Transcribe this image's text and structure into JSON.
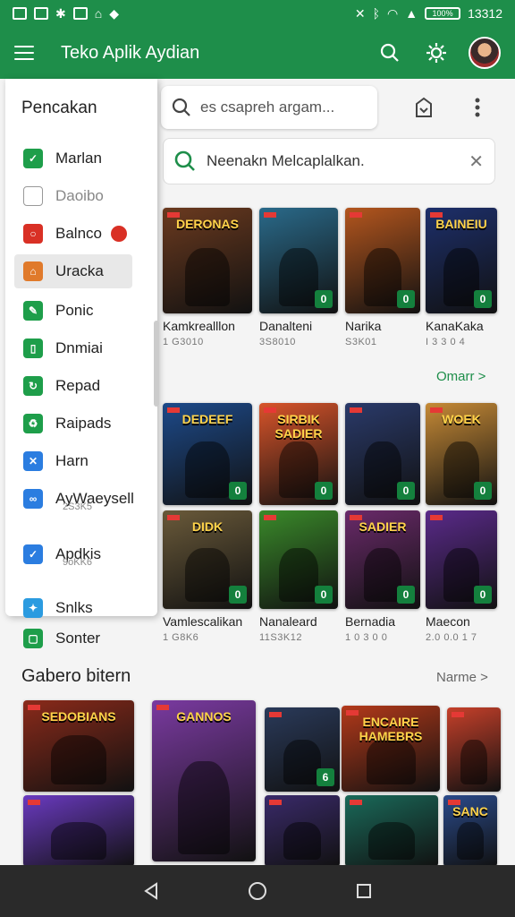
{
  "status": {
    "time": "13312",
    "battery": "100%"
  },
  "appbar": {
    "title": "Teko Aplik Aydian"
  },
  "search": {
    "placeholder": "es csapreh argam..."
  },
  "suggestion": {
    "text": "Neenakn Melcaplalkan.",
    "close": "✕"
  },
  "drawer": {
    "title": "Pencakan",
    "items": [
      {
        "label": "Marlan",
        "color": "#1e9e4a",
        "glyph": "✓"
      },
      {
        "label": "Daoibo",
        "color": "#ffffff",
        "glyph": ""
      },
      {
        "label": "Balnco",
        "color": "#d93025",
        "glyph": "○"
      },
      {
        "label": "Uracka",
        "color": "#e07a2b",
        "glyph": "⌂"
      },
      {
        "label": "Ponic",
        "color": "#1e9e4a",
        "glyph": "✎"
      },
      {
        "label": "Dnmiai",
        "color": "#1e9e4a",
        "glyph": "▯"
      },
      {
        "label": "Repad",
        "color": "#1e9e4a",
        "glyph": "↻"
      },
      {
        "label": "Raipads",
        "color": "#1e9e4a",
        "glyph": "♻"
      },
      {
        "label": "Harn",
        "color": "#2b7de0",
        "glyph": "✕"
      },
      {
        "label": "AyWaeysell",
        "color": "#2b7de0",
        "glyph": "∞"
      },
      {
        "label": "Apdkis",
        "color": "#2b7de0",
        "glyph": "✓"
      },
      {
        "label": "Snlks",
        "color": "#2b9be0",
        "glyph": "✦"
      }
    ],
    "subs": {
      "aywaeysell": "2S3K5",
      "apdkis": "9oKK6"
    }
  },
  "below_drawer": {
    "label": "Sonter"
  },
  "row1": [
    {
      "art": "DERONAS",
      "bg": "#6b3a1f",
      "badge": "",
      "caption": "Kamkrealllon",
      "sub": "1 G3010"
    },
    {
      "art": "",
      "bg": "#2a6a8a",
      "badge": "0",
      "caption": "Danalteni",
      "sub": "3S8010"
    },
    {
      "art": "",
      "bg": "#b4561e",
      "badge": "0",
      "caption": "Narika",
      "sub": "S3K01"
    },
    {
      "art": "BAINEIU",
      "bg": "#1d2f6b",
      "badge": "0",
      "caption": "KanaKaka",
      "sub": "I 3 3 0 4"
    }
  ],
  "link1": "Omarr >",
  "row2": [
    {
      "art": "DEDEEF",
      "bg": "#1d4a8a",
      "badge": "0"
    },
    {
      "art": "SIRBIK SADIER",
      "bg": "#d8542a",
      "badge": "0"
    },
    {
      "art": "",
      "bg": "#2a3a6a",
      "badge": "0"
    },
    {
      "art": "WOEK",
      "bg": "#c68a36",
      "badge": "0"
    }
  ],
  "row3": [
    {
      "art": "DIDK",
      "bg": "#6a5a3a",
      "badge": "0",
      "caption": "Vamlescalikan",
      "sub": "1 G8K6"
    },
    {
      "art": "",
      "bg": "#3a8a2a",
      "badge": "0",
      "caption": "Nanaleard",
      "sub": "11S3K12"
    },
    {
      "art": "SADIER",
      "bg": "#6a2a6a",
      "badge": "0",
      "caption": "Bernadia",
      "sub": "1 0 3 0 0"
    },
    {
      "art": "",
      "bg": "#5a2a8a",
      "badge": "0",
      "caption": "Maecon",
      "sub": "2.0 0.0 1 7"
    }
  ],
  "section2": {
    "title": "Gabero bitern",
    "link": "Narme >"
  },
  "row4": [
    {
      "art": "SEDOBIANS",
      "bg": "#8a2a1a"
    },
    {
      "art": "GANNOS",
      "bg": "#7a3aa0"
    },
    {
      "art": "",
      "bg": "#2a3a5a",
      "badge": "6"
    },
    {
      "art": "ENCAIRE HAMEBRS",
      "bg": "#b3391a"
    },
    {
      "art": "",
      "bg": "#c6402a"
    }
  ],
  "row5": [
    {
      "art": "",
      "bg": "#6a3ac0"
    },
    {
      "art": "",
      "bg": "#3a2a6a"
    },
    {
      "art": "",
      "bg": "#1a6a5a"
    },
    {
      "art": "SANC",
      "bg": "#2a4a8a"
    }
  ],
  "colors": {
    "brand": "#1e8e4a",
    "link": "#1e8e4a",
    "navbar": "#2a2a2a"
  }
}
